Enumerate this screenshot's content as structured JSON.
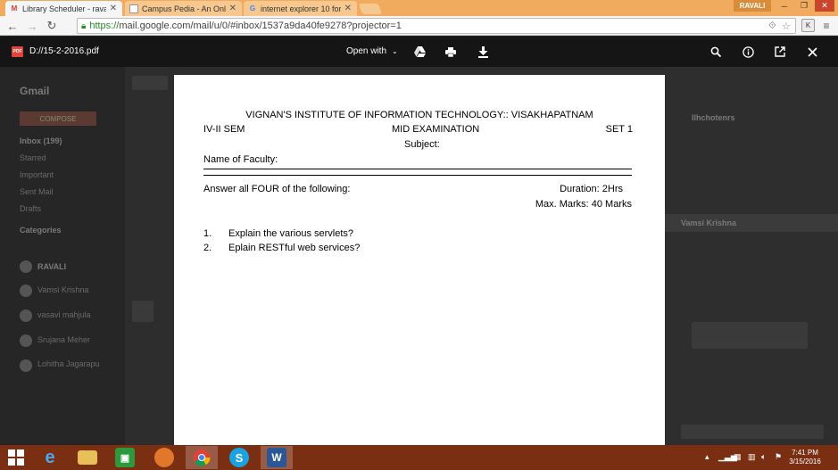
{
  "browser": {
    "tabs": [
      {
        "title": "Library Scheduler - ravali.5",
        "active": true,
        "icon": "gmail-icon"
      },
      {
        "title": "Campus Pedia - An Online",
        "active": false,
        "icon": "page-icon"
      },
      {
        "title": "internet explorer 10 for wi",
        "active": false,
        "icon": "google-icon"
      }
    ],
    "profile_name": "RAVALI",
    "url_secure": "https://",
    "url_rest": "mail.google.com/mail/u/0/#inbox/1537a9da40fe9278?projector=1",
    "extension_label": "K"
  },
  "pdf_viewer": {
    "file_name": "D://15-2-2016.pdf",
    "open_with_label": "Open with",
    "icons": [
      "drive-icon",
      "print-icon",
      "download-icon",
      "zoom-icon",
      "info-icon",
      "open-external-icon",
      "close-icon"
    ]
  },
  "document": {
    "institute": "VIGNAN'S INSTITUTE OF INFORMATION TECHNOLOGY:: VISAKHAPATNAM",
    "semester": "IV-II SEM",
    "exam": "MID EXAMINATION",
    "set": "SET 1",
    "subject_label": "Subject:",
    "faculty_label": "Name of Faculty:",
    "instruction": "Answer all FOUR of the following:",
    "duration": "Duration: 2Hrs",
    "max_marks": "Max. Marks: 40 Marks",
    "questions": [
      {
        "num": "1.",
        "text": "Explain the various servlets?"
      },
      {
        "num": "2.",
        "text": "Eplain RESTful web services?"
      }
    ]
  },
  "gmail_background": {
    "brand": "Gmail",
    "compose": "COMPOSE",
    "folders": [
      "Inbox (199)",
      "Starred",
      "Important",
      "Sent Mail",
      "Drafts",
      "Categories"
    ],
    "contacts": [
      "RAVALI",
      "Vamsi Krishna",
      "vasavi mahjula",
      "Srujana Meher",
      "Lohitha Jagarapu"
    ],
    "panel_title": "Vamsi Krishna",
    "panel_side_title": "Ilhchotenrs"
  },
  "taskbar": {
    "apps": [
      "windows-start-icon",
      "internet-explorer-icon",
      "file-explorer-icon",
      "store-icon",
      "firefox-icon",
      "chrome-icon",
      "skype-icon",
      "word-icon"
    ],
    "time": "7:41 PM",
    "date": "3/15/2016"
  }
}
